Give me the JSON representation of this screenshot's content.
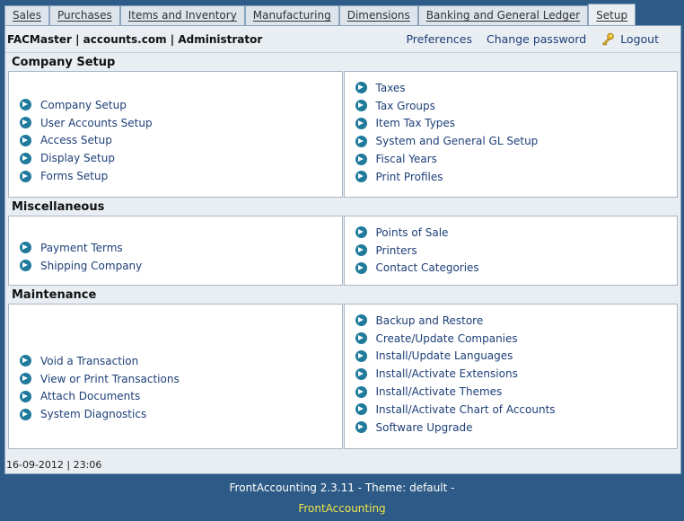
{
  "tabs": [
    {
      "label": "Sales"
    },
    {
      "label": "Purchases"
    },
    {
      "label": "Items and Inventory"
    },
    {
      "label": "Manufacturing"
    },
    {
      "label": "Dimensions"
    },
    {
      "label": "Banking and General Ledger"
    },
    {
      "label": "Setup",
      "active": true
    }
  ],
  "header": {
    "user_info": "FACMaster | accounts.com | Administrator",
    "preferences": "Preferences",
    "change_password": "Change password",
    "logout": "Logout"
  },
  "sections": [
    {
      "title": "Company Setup",
      "left": [
        "Company Setup",
        "User Accounts Setup",
        "Access Setup",
        "Display Setup",
        "Forms Setup"
      ],
      "right": [
        "Taxes",
        "Tax Groups",
        "Item Tax Types",
        "System and General GL Setup",
        "Fiscal Years",
        "Print Profiles"
      ]
    },
    {
      "title": "Miscellaneous",
      "left": [
        "Payment Terms",
        "Shipping Company"
      ],
      "right": [
        "Points of Sale",
        "Printers",
        "Contact Categories"
      ]
    },
    {
      "title": "Maintenance",
      "left": [
        "Void a Transaction",
        "View or Print Transactions",
        "Attach Documents",
        "System Diagnostics"
      ],
      "right": [
        "Backup and Restore",
        "Create/Update Companies",
        "Install/Update Languages",
        "Install/Activate Extensions",
        "Install/Activate Themes",
        "Install/Activate Chart of Accounts",
        "Software Upgrade"
      ]
    }
  ],
  "status": {
    "datetime": "16-09-2012 | 23:06"
  },
  "footer": {
    "version": "FrontAccounting 2.3.11 - Theme: default -",
    "link": "FrontAccounting"
  },
  "colors": {
    "background": "#2d5a86",
    "panel": "#ffffff",
    "link": "#1d3f78",
    "bullet": "#1f7a9c",
    "footer_link": "#f0e54a"
  },
  "icons": {
    "logout": "key-icon",
    "menu_item": "arrow-bullet-icon"
  }
}
